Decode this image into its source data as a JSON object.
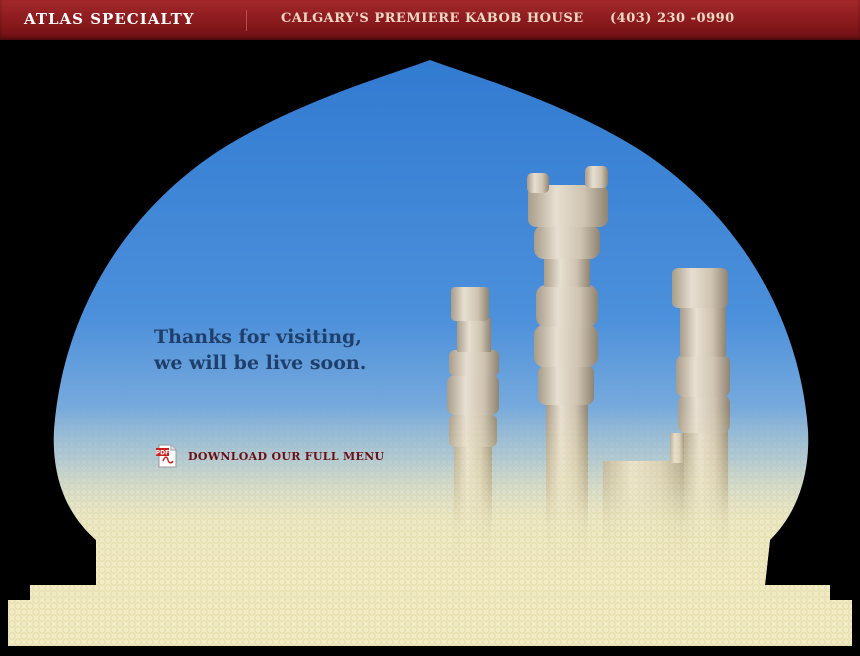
{
  "header": {
    "brand": "ATLAS SPECIALTY",
    "tagline": "CALGARY'S PREMIERE KABOB HOUSE",
    "phone": "(403) 230 -0990"
  },
  "main": {
    "message_line1": "Thanks for visiting,",
    "message_line2": "we will be live soon.",
    "download_link": "DOWNLOAD OUR FULL MENU",
    "pdf_icon_label": "PDF"
  },
  "colors": {
    "header_red": "#8a1a1d",
    "sky_blue": "#3f86d6",
    "message_blue": "#1f3f6a",
    "link_maroon": "#6b0f12",
    "cream_pattern": "#f1ebc4"
  }
}
